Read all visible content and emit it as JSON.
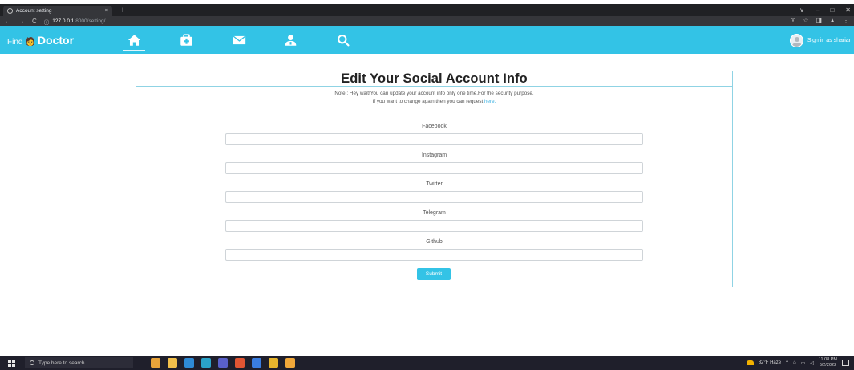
{
  "browser": {
    "tab_title": "Account setting",
    "tab_close": "×",
    "new_tab": "+",
    "url_host": "127.0.0.1",
    "url_path": ":8000/setting/",
    "nav_back": "←",
    "nav_forward": "→",
    "nav_reload": "C",
    "window_controls": [
      "∨",
      "–",
      "□",
      "✕"
    ]
  },
  "navbar": {
    "brand_prefix": "Find",
    "brand_name": "Doctor",
    "nav_icons": [
      "home-icon",
      "medical-kit-icon",
      "mail-icon",
      "doctors-icon",
      "search-icon"
    ],
    "signin_text": "Sign in as shariar",
    "accent_color": "#33c3e6"
  },
  "card": {
    "title": "Edit Your Social Account Info",
    "note_line1": "Note : Hey wait!You can update your account info only one time.For the security purpose.",
    "note_line2_prefix": "If you want to change again then you can request",
    "note_link": "here.",
    "fields": [
      {
        "label": "Facebook",
        "value": ""
      },
      {
        "label": "Instagram",
        "value": ""
      },
      {
        "label": "Twitter",
        "value": ""
      },
      {
        "label": "Telegram",
        "value": ""
      },
      {
        "label": "Github",
        "value": ""
      }
    ],
    "submit_label": "Submit"
  },
  "taskbar": {
    "search_placeholder": "Type here to search",
    "weather": "82°F Haze",
    "time": "11:08 PM",
    "date": "6/2/2022",
    "app_colors": [
      "#e8a33a",
      "#f2c04b",
      "#2e8bd6",
      "#2aa3c9",
      "#5960c9",
      "#e25533",
      "#3a7de0",
      "#e7b52d",
      "#f1a83a"
    ]
  }
}
